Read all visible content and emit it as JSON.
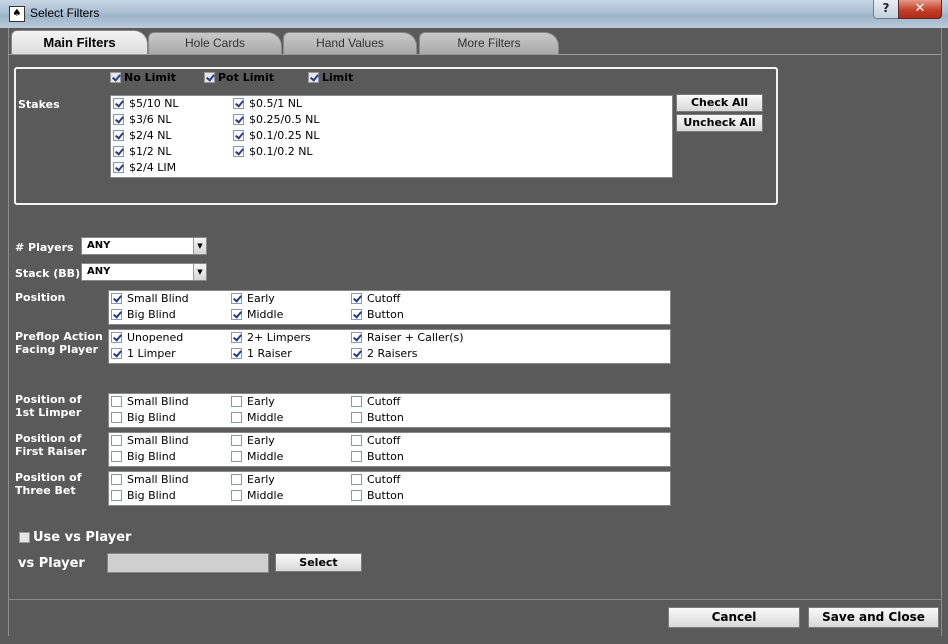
{
  "window": {
    "title": "Select Filters",
    "help_label": "?",
    "close_label": "✕"
  },
  "tabs": [
    {
      "label": "Main Filters"
    },
    {
      "label": "Hole Cards"
    },
    {
      "label": "Hand Values"
    },
    {
      "label": "More Filters"
    }
  ],
  "stakes": {
    "label": "Stakes",
    "types": [
      {
        "label": "No Limit",
        "checked": true
      },
      {
        "label": "Pot Limit",
        "checked": true
      },
      {
        "label": "Limit",
        "checked": true
      }
    ],
    "col1": [
      "$5/10 NL",
      "$3/6 NL",
      "$2/4 NL",
      "$1/2 NL",
      "$2/4 LIM"
    ],
    "col2": [
      "$0.5/1 NL",
      "$0.25/0.5 NL",
      "$0.1/0.25 NL",
      "$0.1/0.2 NL"
    ],
    "check_all": "Check All",
    "uncheck_all": "Uncheck All"
  },
  "players": {
    "label": "# Players",
    "value": "ANY"
  },
  "stack": {
    "label": "Stack (BB)",
    "value": "ANY"
  },
  "position": {
    "label": "Position",
    "items": [
      "Small Blind",
      "Early",
      "Cutoff",
      "Big Blind",
      "Middle",
      "Button"
    ]
  },
  "preflop": {
    "label1": "Preflop Action",
    "label2": "Facing Player",
    "items": [
      "Unopened",
      "2+ Limpers",
      "Raiser + Caller(s)",
      "1 Limper",
      "1 Raiser",
      "2 Raisers"
    ]
  },
  "pos_first_limper": {
    "label1": "Position of",
    "label2": "1st Limper",
    "items": [
      "Small Blind",
      "Early",
      "Cutoff",
      "Big Blind",
      "Middle",
      "Button"
    ]
  },
  "pos_first_raiser": {
    "label1": "Position of",
    "label2": "First Raiser",
    "items": [
      "Small Blind",
      "Early",
      "Cutoff",
      "Big Blind",
      "Middle",
      "Button"
    ]
  },
  "pos_three_bet": {
    "label1": "Position of",
    "label2": "Three Bet",
    "items": [
      "Small Blind",
      "Early",
      "Cutoff",
      "Big Blind",
      "Middle",
      "Button"
    ]
  },
  "vs_player": {
    "use_label": "Use vs Player",
    "label": "vs Player",
    "value": "",
    "select_button": "Select"
  },
  "footer": {
    "cancel": "Cancel",
    "save": "Save and Close"
  }
}
